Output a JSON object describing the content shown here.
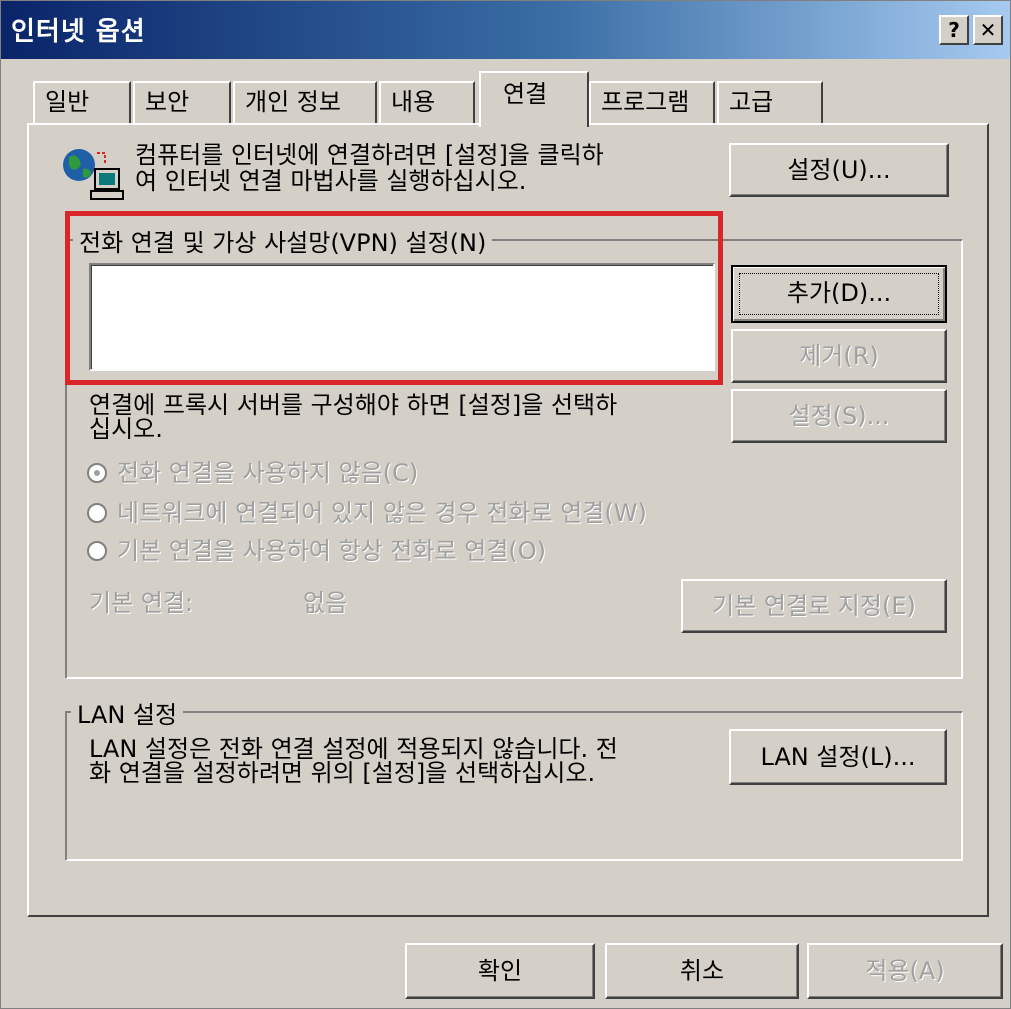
{
  "window": {
    "title": "인터넷 옵션"
  },
  "titlebar_buttons": {
    "help": "?",
    "close": "✕"
  },
  "tabs": [
    {
      "label": "일반"
    },
    {
      "label": "보안"
    },
    {
      "label": "개인 정보"
    },
    {
      "label": "내용"
    },
    {
      "label": "연결"
    },
    {
      "label": "프로그램"
    },
    {
      "label": "고급"
    }
  ],
  "active_tab": "연결",
  "setup": {
    "text_line1": "컴퓨터를 인터넷에 연결하려면 [설정]을 클릭하",
    "text_line2": "여 인터넷 연결 마법사를 실행하십시오.",
    "button": "설정(U)..."
  },
  "dialup": {
    "legend": "전화 연결 및 가상 사설망(VPN) 설정(N)",
    "add_button": "추가(D)...",
    "remove_button": "제거(R)",
    "proxy_text_line1": "연결에 프록시 서버를 구성해야 하면 [설정]을 선택하",
    "proxy_text_line2": "십시오.",
    "settings_button": "설정(S)...",
    "radio_options": [
      {
        "label": "전화 연결을 사용하지 않음(C)",
        "selected": true
      },
      {
        "label": "네트워크에 연결되어 있지 않은 경우 전화로 연결(W)",
        "selected": false
      },
      {
        "label": "기본 연결을 사용하여 항상 전화로 연결(O)",
        "selected": false
      }
    ],
    "default_label": "기본 연결:",
    "default_value": "없음",
    "set_default_button": "기본 연결로 지정(E)"
  },
  "lan": {
    "legend": "LAN 설정",
    "text_line1": "LAN 설정은 전화 연결 설정에 적용되지 않습니다. 전",
    "text_line2": "화 연결을 설정하려면 위의 [설정]을 선택하십시오.",
    "button": "LAN 설정(L)..."
  },
  "footer": {
    "ok": "확인",
    "cancel": "취소",
    "apply": "적용(A)"
  },
  "colors": {
    "highlight_box": "#d9262a",
    "title_start": "#0a246a",
    "title_end": "#a6caf0"
  }
}
